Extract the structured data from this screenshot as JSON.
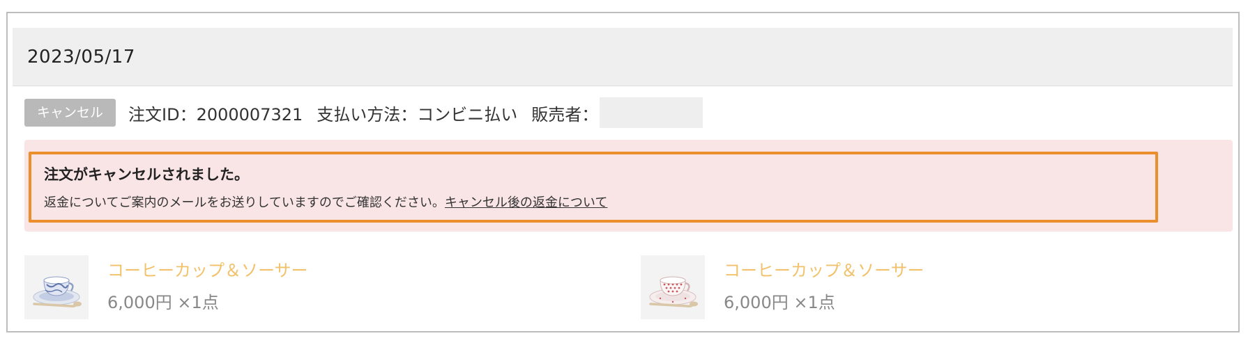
{
  "order": {
    "date": "2023/05/17",
    "status_badge": "キャンセル",
    "order_id": "注文ID：2000007321",
    "payment": "支払い方法：コンビニ払い",
    "seller_label": "販売者："
  },
  "notice": {
    "title": "注文がキャンセルされました。",
    "body": "返金についてご案内のメールをお送りしていますのでご確認ください。",
    "link": "キャンセル後の返金について",
    "highlight_color": "#ea8f2b",
    "background_color": "#fae5e6"
  },
  "items": [
    {
      "name": "コーヒーカップ＆ソーサー",
      "price": "6,000円",
      "qty": "×1点",
      "icon": "cup-blue-pattern-image"
    },
    {
      "name": "コーヒーカップ＆ソーサー",
      "price": "6,000円",
      "qty": "×1点",
      "icon": "cup-red-dots-image"
    }
  ],
  "colors": {
    "item_name": "#f2c16b",
    "badge": "#b9b9b9"
  }
}
